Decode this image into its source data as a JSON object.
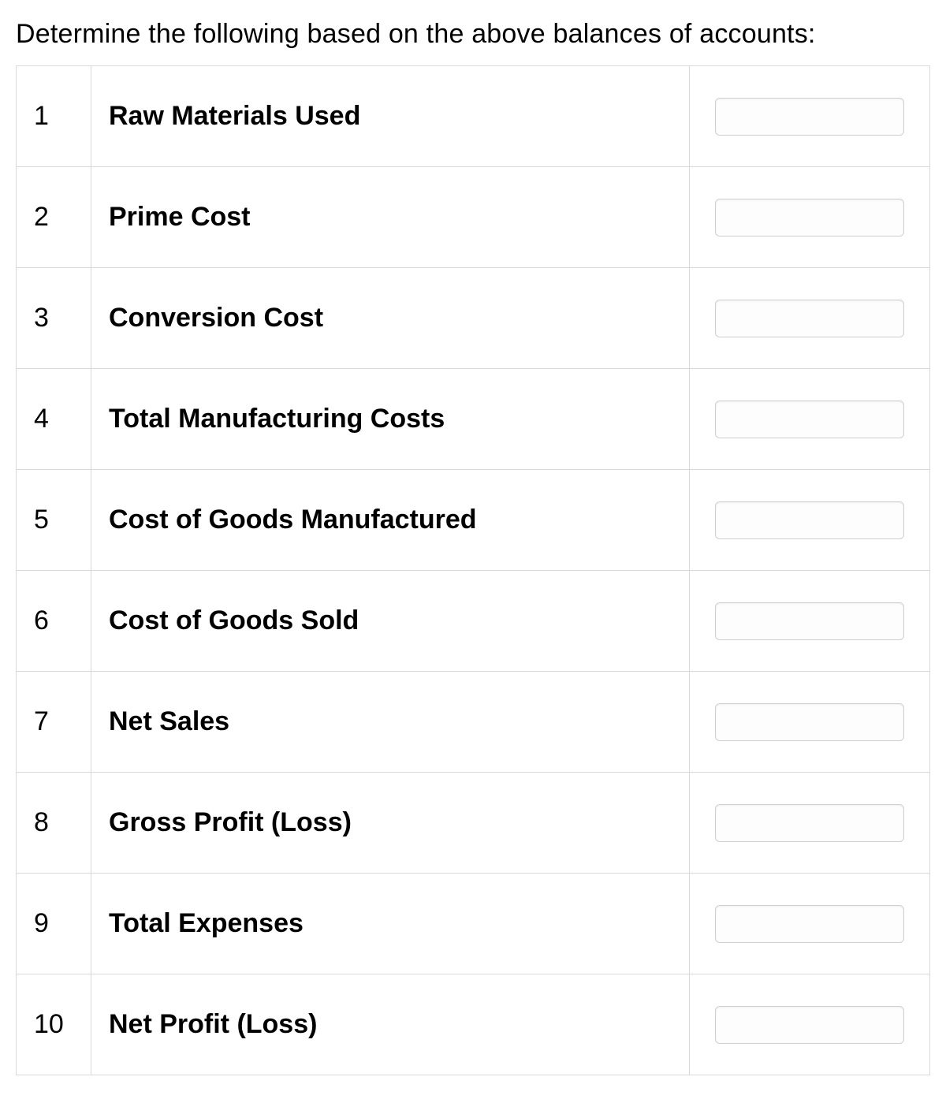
{
  "heading": "Determine the following based on the above balances of accounts:",
  "rows": [
    {
      "num": "1",
      "label": "Raw Materials Used",
      "value": ""
    },
    {
      "num": "2",
      "label": "Prime Cost",
      "value": ""
    },
    {
      "num": "3",
      "label": "Conversion Cost",
      "value": ""
    },
    {
      "num": "4",
      "label": "Total Manufacturing Costs",
      "value": ""
    },
    {
      "num": "5",
      "label": "Cost of Goods Manufactured",
      "value": ""
    },
    {
      "num": "6",
      "label": "Cost of Goods Sold",
      "value": ""
    },
    {
      "num": "7",
      "label": "Net Sales",
      "value": ""
    },
    {
      "num": "8",
      "label": "Gross Profit (Loss)",
      "value": ""
    },
    {
      "num": "9",
      "label": "Total Expenses",
      "value": ""
    },
    {
      "num": "10",
      "label": "Net Profit (Loss)",
      "value": ""
    }
  ]
}
